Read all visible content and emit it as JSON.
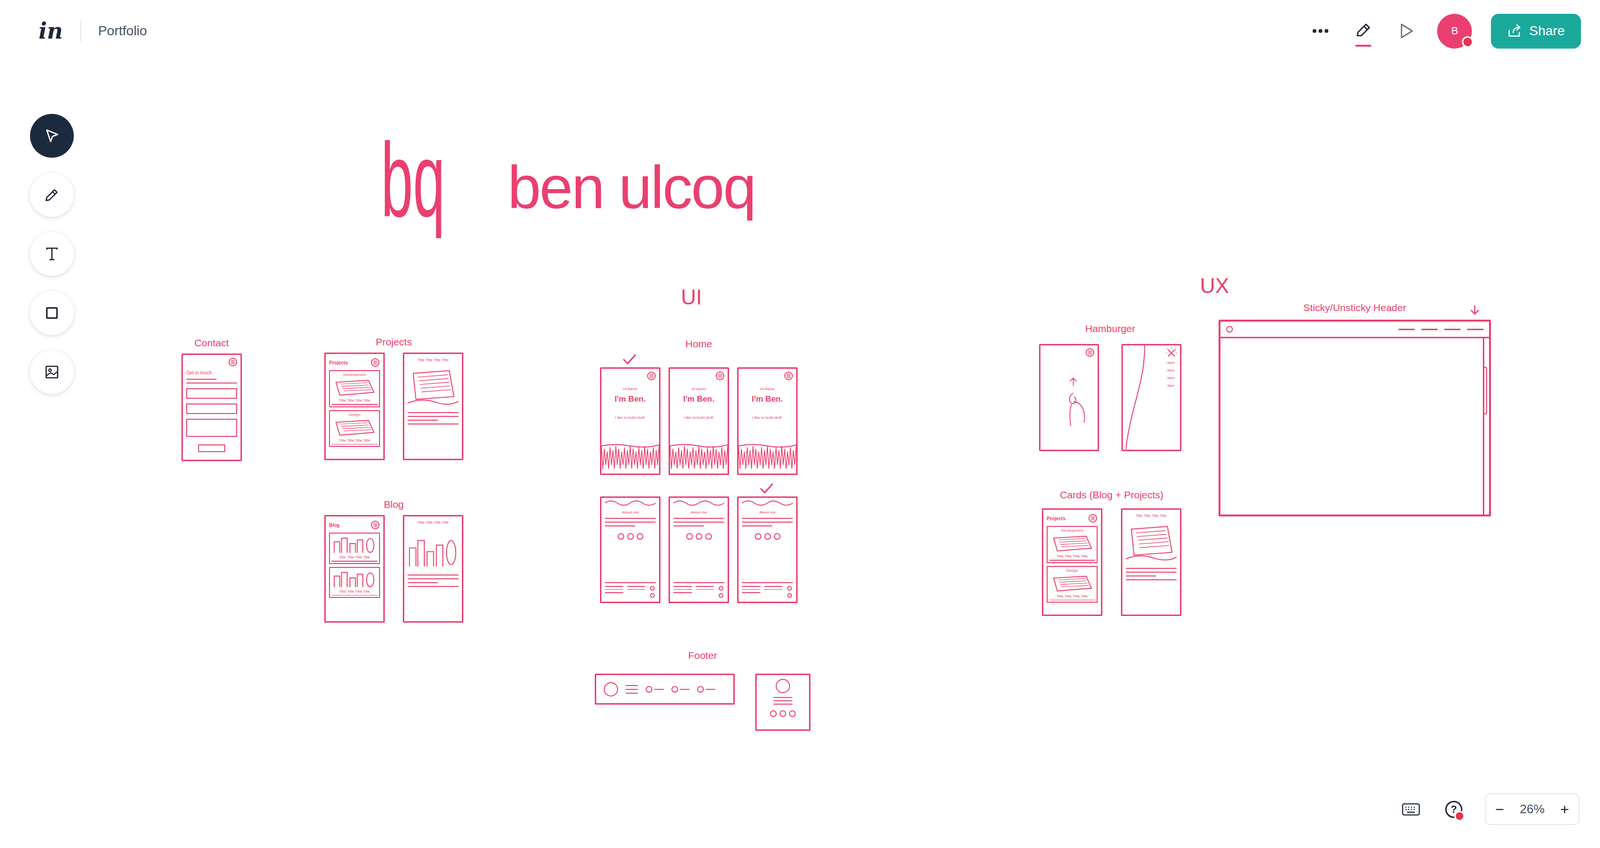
{
  "topbar": {
    "logo": "in",
    "title": "Portfolio",
    "actions": [
      {
        "selected": false
      },
      {
        "selected": true
      },
      {
        "selected": false
      }
    ],
    "avatar": {
      "initial": "B",
      "notification": true
    },
    "share": "Share"
  },
  "toolbar": [
    {
      "selected": true
    },
    {
      "selected": false
    },
    {
      "selected": false
    },
    {
      "selected": false
    },
    {
      "selected": false
    }
  ],
  "bottom": {
    "help": "?",
    "help_notification": true,
    "zoom": {
      "minus": "−",
      "level": "26%",
      "plus": "+"
    }
  },
  "canvas": {
    "logo": "bq",
    "title": "ben ulcoq",
    "sections": [
      {
        "label": "UI"
      },
      {
        "label": "UX"
      }
    ],
    "groups": [
      {
        "label": "Contact",
        "frames": [
          {
            "kind": "contact",
            "heading": "Get in touch"
          }
        ]
      },
      {
        "label": "Projects",
        "frames": [
          {
            "kind": "projects-list",
            "heading": "Projects",
            "items": [
              {
                "tag": "Development",
                "caption": "Title Title Title Title"
              },
              {
                "tag": "Design",
                "caption": "Title Title Title Title"
              }
            ]
          },
          {
            "kind": "projects-detail",
            "heading": "Title Title Title Title"
          }
        ]
      },
      {
        "label": "Blog",
        "frames": [
          {
            "kind": "blog-list",
            "heading": "Blog",
            "items": [
              {
                "caption": "Title Title Title Title"
              },
              {
                "caption": "Title Title Title Title"
              }
            ]
          },
          {
            "kind": "blog-detail",
            "heading": "Title Title Title Title"
          }
        ]
      },
      {
        "label": "Home",
        "frames": [
          {
            "kind": "hero",
            "greeting": "Hi there!",
            "name": "I'm Ben.",
            "tagline": "I like to build stuff.",
            "selected": true
          },
          {
            "kind": "hero",
            "greeting": "Hi there!",
            "name": "I'm Ben.",
            "tagline": "I like to build stuff.",
            "selected": false
          },
          {
            "kind": "hero",
            "greeting": "Hi there!",
            "name": "I'm Ben.",
            "tagline": "I like to build stuff.",
            "selected": false
          },
          {
            "kind": "about",
            "heading": "About me",
            "selected": false
          },
          {
            "kind": "about",
            "heading": "About me",
            "selected": false
          },
          {
            "kind": "about",
            "heading": "About me",
            "selected": true
          }
        ]
      },
      {
        "label": "Footer",
        "frames": [
          {
            "kind": "footer-wide"
          },
          {
            "kind": "footer-narrow"
          }
        ]
      },
      {
        "label": "Hamburger",
        "frames": [
          {
            "kind": "menu-closed"
          },
          {
            "kind": "menu-open",
            "menu": [
              "Item",
              "Item",
              "Item",
              "Item"
            ]
          }
        ]
      },
      {
        "label": "Cards (Blog + Projects)",
        "frames": [
          {
            "kind": "projects-list",
            "heading": "Projects",
            "items": [
              {
                "tag": "Development",
                "caption": "Title Title Title Title"
              },
              {
                "tag": "Design",
                "caption": "Title Title Title Title"
              }
            ]
          },
          {
            "kind": "projects-detail",
            "heading": "Title Title Title Title"
          }
        ]
      },
      {
        "label": "Sticky/Unsticky Header",
        "frames": [
          {
            "kind": "browser"
          }
        ]
      }
    ]
  }
}
